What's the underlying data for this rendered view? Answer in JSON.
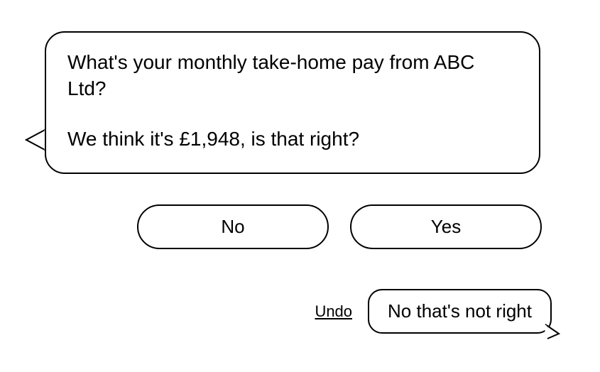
{
  "bot_message": {
    "line1": "What's your monthly take-home pay from ABC Ltd?",
    "line2": "We think it's £1,948, is that right?"
  },
  "options": {
    "no": "No",
    "yes": "Yes"
  },
  "undo_label": "Undo",
  "user_reply": "No that's not right"
}
